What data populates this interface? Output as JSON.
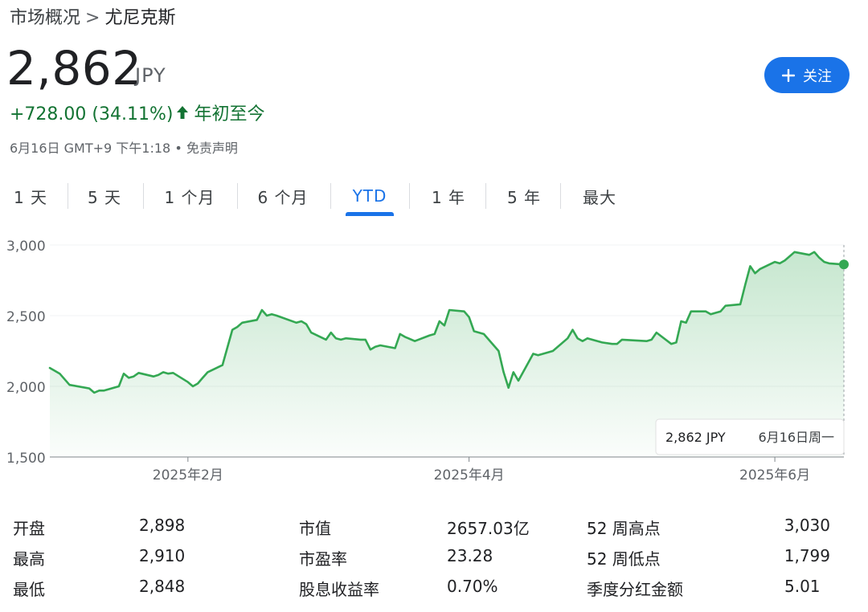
{
  "breadcrumb": {
    "parent": "市场概况",
    "separator": ">",
    "current": "尤尼克斯"
  },
  "quote": {
    "price": "2,862",
    "currency": "JPY",
    "change": "+728.00 (34.11%)",
    "period": "年初至今",
    "timestamp": "6月16日 GMT+9 下午1:18",
    "bullet": "•",
    "disclaimer": "免责声明",
    "up_color": "#137333"
  },
  "follow_button": {
    "icon": "plus-icon",
    "label": "关注",
    "color": "#1a73e8"
  },
  "ranges": {
    "tabs": [
      "1 天",
      "5 天",
      "1 个月",
      "6 个月",
      "YTD",
      "1 年",
      "5 年",
      "最大"
    ],
    "active": "YTD"
  },
  "chart_data": {
    "type": "area",
    "line_color": "#34a853",
    "y_ticks": [
      "3,000",
      "2,500",
      "2,000",
      "1,500"
    ],
    "y_tick_values": [
      3000,
      2500,
      2000,
      1500
    ],
    "ylim": [
      1500,
      3000
    ],
    "x_labels": [
      "2025年2月",
      "2025年4月",
      "2025年6月"
    ],
    "x_label_dates": [
      "2025-02-03",
      "2025-04-01",
      "2025-06-02"
    ],
    "xlim": [
      "2025-01-06",
      "2025-06-16"
    ],
    "grid": true,
    "series": [
      {
        "x": [
          "2025-01-06",
          "2025-01-07",
          "2025-01-08",
          "2025-01-09",
          "2025-01-10",
          "2025-01-14",
          "2025-01-15",
          "2025-01-16",
          "2025-01-17",
          "2025-01-20",
          "2025-01-21",
          "2025-01-22",
          "2025-01-23",
          "2025-01-24",
          "2025-01-27",
          "2025-01-28",
          "2025-01-29",
          "2025-01-30",
          "2025-01-31",
          "2025-02-03",
          "2025-02-04",
          "2025-02-05",
          "2025-02-06",
          "2025-02-07",
          "2025-02-10",
          "2025-02-12",
          "2025-02-13",
          "2025-02-14",
          "2025-02-17",
          "2025-02-18",
          "2025-02-19",
          "2025-02-20",
          "2025-02-21",
          "2025-02-25",
          "2025-02-26",
          "2025-02-27",
          "2025-02-28",
          "2025-03-03",
          "2025-03-04",
          "2025-03-05",
          "2025-03-06",
          "2025-03-07",
          "2025-03-10",
          "2025-03-11",
          "2025-03-12",
          "2025-03-13",
          "2025-03-14",
          "2025-03-17",
          "2025-03-18",
          "2025-03-19",
          "2025-03-21",
          "2025-03-24",
          "2025-03-25",
          "2025-03-26",
          "2025-03-27",
          "2025-03-28",
          "2025-03-31",
          "2025-04-01",
          "2025-04-02",
          "2025-04-03",
          "2025-04-04",
          "2025-04-07",
          "2025-04-08",
          "2025-04-09",
          "2025-04-10",
          "2025-04-11",
          "2025-04-14",
          "2025-04-15",
          "2025-04-16",
          "2025-04-17",
          "2025-04-18",
          "2025-04-21",
          "2025-04-22",
          "2025-04-23",
          "2025-04-24",
          "2025-04-25",
          "2025-04-28",
          "2025-04-30",
          "2025-05-01",
          "2025-05-02",
          "2025-05-07",
          "2025-05-08",
          "2025-05-09",
          "2025-05-12",
          "2025-05-13",
          "2025-05-14",
          "2025-05-15",
          "2025-05-16",
          "2025-05-19",
          "2025-05-20",
          "2025-05-21",
          "2025-05-22",
          "2025-05-23",
          "2025-05-26",
          "2025-05-27",
          "2025-05-28",
          "2025-05-29",
          "2025-05-30",
          "2025-06-02",
          "2025-06-03",
          "2025-06-04",
          "2025-06-05",
          "2025-06-06",
          "2025-06-09",
          "2025-06-10",
          "2025-06-11",
          "2025-06-12",
          "2025-06-13",
          "2025-06-16"
        ],
        "y": [
          2130,
          2110,
          2090,
          2050,
          2010,
          1985,
          1955,
          1970,
          1970,
          2000,
          2090,
          2060,
          2070,
          2095,
          2070,
          2080,
          2100,
          2090,
          2095,
          2030,
          2000,
          2020,
          2060,
          2100,
          2150,
          2400,
          2420,
          2450,
          2470,
          2540,
          2500,
          2510,
          2500,
          2450,
          2460,
          2440,
          2380,
          2330,
          2380,
          2340,
          2330,
          2340,
          2330,
          2330,
          2260,
          2280,
          2290,
          2270,
          2370,
          2350,
          2320,
          2360,
          2370,
          2460,
          2430,
          2540,
          2530,
          2490,
          2390,
          2380,
          2370,
          2250,
          2100,
          1990,
          2100,
          2040,
          2230,
          2220,
          2230,
          2240,
          2250,
          2340,
          2400,
          2340,
          2320,
          2340,
          2310,
          2300,
          2300,
          2330,
          2320,
          2330,
          2380,
          2300,
          2310,
          2460,
          2450,
          2530,
          2530,
          2510,
          2520,
          2530,
          2570,
          2580,
          2720,
          2850,
          2800,
          2830,
          2880,
          2870,
          2890,
          2920,
          2950,
          2930,
          2950,
          2910,
          2880,
          2870,
          2862
        ]
      }
    ],
    "tooltip": {
      "value": "2,862 JPY",
      "date": "6月16日周一"
    }
  },
  "stats": [
    {
      "label": "开盘",
      "value": "2,898"
    },
    {
      "label": "最高",
      "value": "2,910"
    },
    {
      "label": "最低",
      "value": "2,848"
    },
    {
      "label": "市值",
      "value": "2657.03亿"
    },
    {
      "label": "市盈率",
      "value": "23.28"
    },
    {
      "label": "股息收益率",
      "value": "0.70%"
    },
    {
      "label": "52 周高点",
      "value": "3,030"
    },
    {
      "label": "52 周低点",
      "value": "1,799"
    },
    {
      "label": "季度分红金额",
      "value": "5.01"
    }
  ]
}
